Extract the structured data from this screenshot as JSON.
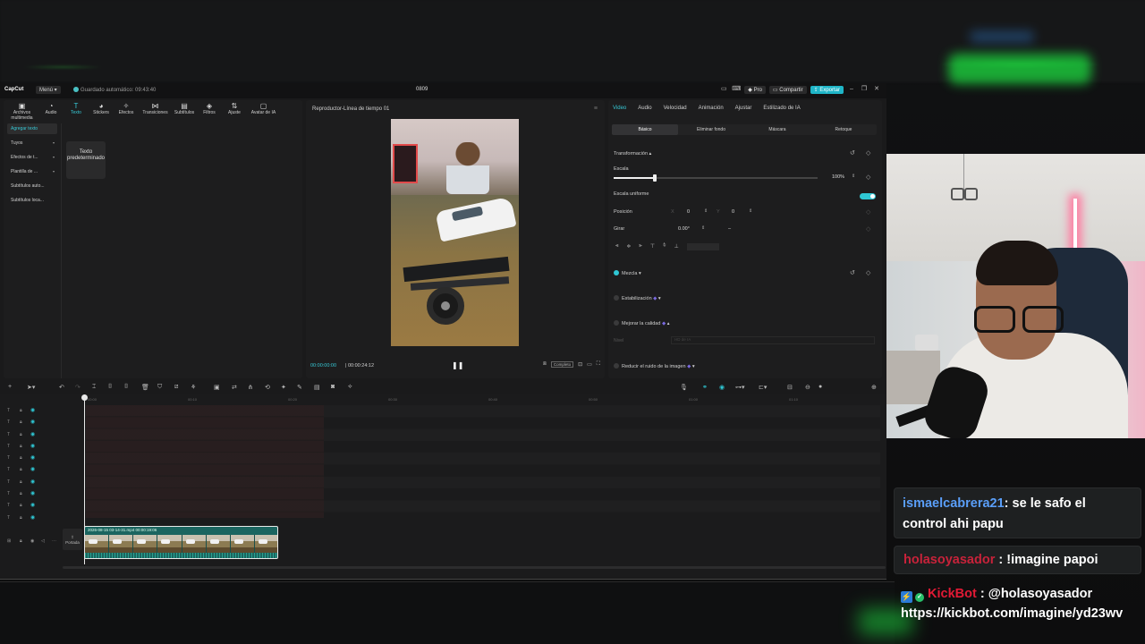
{
  "app": {
    "logo": "CapCut",
    "menu_label": "Menú",
    "autosave": "Guardado automático: 09:43:40",
    "project_name": "0809",
    "pro_label": "Pro",
    "share_label": "Compartir",
    "export_label": "Exportar"
  },
  "toolbar": {
    "items": [
      {
        "label": "Archivos multimedia",
        "icon": "media-icon"
      },
      {
        "label": "Audio",
        "icon": "audio-icon"
      },
      {
        "label": "Texto",
        "icon": "text-icon",
        "active": true
      },
      {
        "label": "Stickers",
        "icon": "sticker-icon"
      },
      {
        "label": "Efectos",
        "icon": "effects-icon"
      },
      {
        "label": "Transiciones",
        "icon": "transitions-icon"
      },
      {
        "label": "Subtítulos",
        "icon": "captions-icon"
      },
      {
        "label": "Filtros",
        "icon": "filters-icon"
      },
      {
        "label": "Ajuste",
        "icon": "adjust-icon"
      },
      {
        "label": "Avatar de IA",
        "icon": "avatar-icon"
      }
    ]
  },
  "text_panel": {
    "subnav": [
      "Agregar texto",
      "Tuyos",
      "Efectos de t...",
      "Plantilla de ...",
      "Subtítulos auto...",
      "Subtítulos loca..."
    ],
    "card_label": "Texto predeterminado"
  },
  "player": {
    "title": "Reproductor-Línea de tiempo 01",
    "current_time": "00:00:00:00",
    "duration": "00:00:24:12",
    "ratio_label": "Completo"
  },
  "inspector": {
    "tabs": [
      "Video",
      "Audio",
      "Velocidad",
      "Animación",
      "Ajustar",
      "Estilizado de IA"
    ],
    "subtabs": [
      "Básico",
      "Eliminar fondo",
      "Máscara",
      "Retoque"
    ],
    "transform_label": "Transformación",
    "scale_label": "Escala",
    "scale_value": "100%",
    "scale_fraction": 0.2,
    "uniform_label": "Escala uniforme",
    "position_label": "Posición",
    "x_label": "X",
    "x_value": "0",
    "y_label": "Y",
    "y_value": "0",
    "rotate_label": "Girar",
    "rotate_value": "0.00°",
    "rotate_dash": "–",
    "blend_label": "Mezcla",
    "stabilize_label": "Estabilización",
    "enhance_label": "Mejorar la calidad",
    "quality_label": "Nivel",
    "quality_value": "HD de IA",
    "denoise_label": "Reducir el ruido de la imagen"
  },
  "timeline": {
    "ruler": [
      "00:00",
      "00:10",
      "00:20",
      "00:30",
      "00:40",
      "00:50",
      "01:00",
      "01:10"
    ],
    "track_count": 10,
    "cover_label": "Portada",
    "clip_label": "2026-08-15 03-14-31.mp4   00:00:19:06"
  },
  "chat": [
    {
      "user": "ismaelcabrera21",
      "text": "se le safo el control ahi papu",
      "color": "#5a9ef8"
    },
    {
      "user": "holasoyasador",
      "text": "!imagine papoi",
      "color": "#c8223a"
    },
    {
      "user": "KickBot",
      "mention": "@holasoyasador",
      "text": "https://kickbot.com/imagine/yd23wv",
      "color": "#e21a35"
    }
  ]
}
